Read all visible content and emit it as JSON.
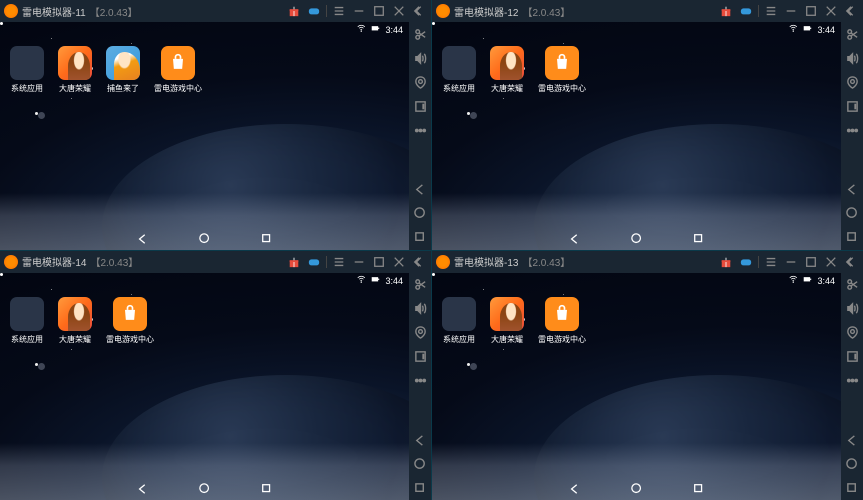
{
  "instances": [
    {
      "title": "雷电模拟器-11",
      "version": "【2.0.43】",
      "time": "3:44",
      "apps": [
        {
          "label": "系统应用",
          "icon": "system"
        },
        {
          "label": "大唐荣耀",
          "icon": "game1"
        },
        {
          "label": "捕鱼来了",
          "icon": "game2"
        },
        {
          "label": "雷电游戏中心",
          "icon": "store"
        }
      ]
    },
    {
      "title": "雷电模拟器-12",
      "version": "【2.0.43】",
      "time": "3:44",
      "apps": [
        {
          "label": "系统应用",
          "icon": "system"
        },
        {
          "label": "大唐荣耀",
          "icon": "game1"
        },
        {
          "label": "雷电游戏中心",
          "icon": "store"
        }
      ]
    },
    {
      "title": "雷电模拟器-14",
      "version": "【2.0.43】",
      "time": "3:44",
      "apps": [
        {
          "label": "系统应用",
          "icon": "system"
        },
        {
          "label": "大唐荣耀",
          "icon": "game1"
        },
        {
          "label": "雷电游戏中心",
          "icon": "store"
        }
      ]
    },
    {
      "title": "雷电模拟器-13",
      "version": "【2.0.43】",
      "time": "3:44",
      "apps": [
        {
          "label": "系统应用",
          "icon": "system"
        },
        {
          "label": "大唐荣耀",
          "icon": "game1"
        },
        {
          "label": "雷电游戏中心",
          "icon": "store"
        }
      ]
    }
  ],
  "titlebar_icons": [
    "gift",
    "gamepad",
    "menu",
    "minimize",
    "maximize",
    "close",
    "collapse"
  ],
  "sidebar_icons": [
    "scissors",
    "volume",
    "location",
    "expand",
    "more",
    "back-nav",
    "home-nav",
    "recent-nav"
  ]
}
